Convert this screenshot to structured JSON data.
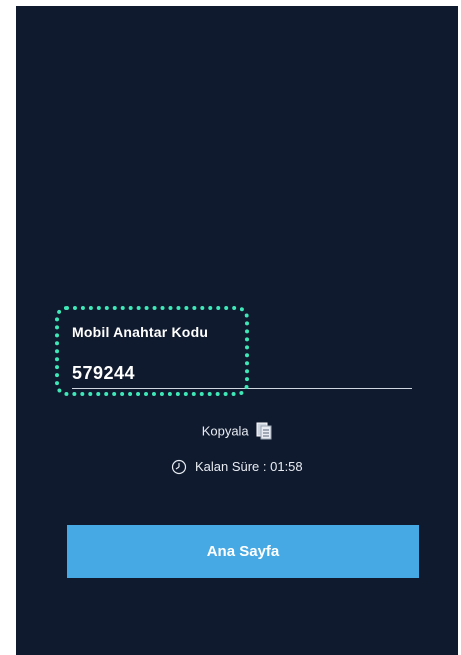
{
  "key_field": {
    "label": "Mobil Anahtar Kodu",
    "value": "579244"
  },
  "copy": {
    "label": "Kopyala",
    "icon": "copy-icon"
  },
  "timer": {
    "label": "Kalan Süre : 01:58",
    "icon": "clock-icon"
  },
  "home_button": {
    "label": "Ana Sayfa"
  },
  "colors": {
    "background": "#0f1a2e",
    "button": "#47a9e3",
    "highlight": "#3ee8b7"
  }
}
